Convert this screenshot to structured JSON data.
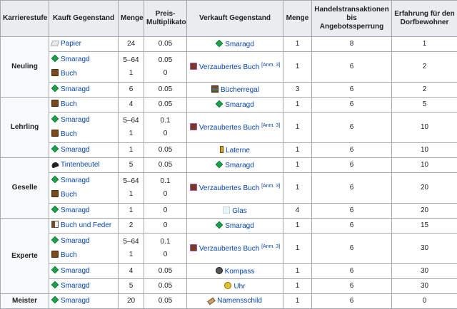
{
  "headers": [
    "Karrierestufe",
    "Kauft Gegenstand",
    "Menge",
    "Preis-Multiplikator",
    "Verkauft Gegenstand",
    "Menge",
    "Handelstransaktionen bis Angebotssperrung",
    "Erfahrung für den Dorfbewohner"
  ],
  "note": "[Anm. 3]",
  "careers": [
    "Neuling",
    "Lehrling",
    "Geselle",
    "Experte",
    "Meister"
  ],
  "rows": [
    {
      "buy": [
        {
          "icon": "paper-icon",
          "name": "Papier"
        }
      ],
      "qty": [
        "24"
      ],
      "mult": [
        "0.05"
      ],
      "sell": {
        "icon": "bookshelf-icon",
        "name": "Smaragd",
        "cls": "emerald"
      },
      "sqty": "1",
      "trades": "8",
      "xp": "1"
    },
    {
      "buy": [
        {
          "name": "Smaragd"
        },
        {
          "name": "Buch"
        }
      ],
      "qty": [
        "5–64",
        "1"
      ],
      "mult": [
        "0.05",
        "0"
      ],
      "sell": {
        "name": "Verzaubertes Buch"
      },
      "sqty": "1",
      "trades": "6",
      "xp": "2"
    },
    {
      "buy": [
        {
          "name": "Smaragd"
        }
      ],
      "qty": [
        "6"
      ],
      "mult": [
        "0.05"
      ],
      "sell": {
        "name": "Bücherregal"
      },
      "sqty": "3",
      "trades": "6",
      "xp": "2"
    },
    {
      "buy": [
        {
          "name": "Buch"
        }
      ],
      "qty": [
        "4"
      ],
      "mult": [
        "0.05"
      ],
      "sell": {
        "name": "Smaragd"
      },
      "sqty": "1",
      "trades": "6",
      "xp": "5"
    },
    {
      "buy": [
        {
          "name": "Smaragd"
        },
        {
          "name": "Buch"
        }
      ],
      "qty": [
        "5–64",
        "1"
      ],
      "mult": [
        "0.1",
        "0"
      ],
      "sell": {
        "name": "Verzaubertes Buch"
      },
      "sqty": "1",
      "trades": "6",
      "xp": "10"
    },
    {
      "buy": [
        {
          "name": "Smaragd"
        }
      ],
      "qty": [
        "1"
      ],
      "mult": [
        "0.05"
      ],
      "sell": {
        "name": "Laterne"
      },
      "sqty": "1",
      "trades": "6",
      "xp": "10"
    },
    {
      "buy": [
        {
          "name": "Tintenbeutel"
        }
      ],
      "qty": [
        "5"
      ],
      "mult": [
        "0.05"
      ],
      "sell": {
        "name": "Smaragd"
      },
      "sqty": "1",
      "trades": "6",
      "xp": "10"
    },
    {
      "buy": [
        {
          "name": "Smaragd"
        },
        {
          "name": "Buch"
        }
      ],
      "qty": [
        "5–64",
        "1"
      ],
      "mult": [
        "0.1",
        "0"
      ],
      "sell": {
        "name": "Verzaubertes Buch"
      },
      "sqty": "1",
      "trades": "6",
      "xp": "20"
    },
    {
      "buy": [
        {
          "name": "Smaragd"
        }
      ],
      "qty": [
        "1"
      ],
      "mult": [
        "0"
      ],
      "sell": {
        "name": "Glas"
      },
      "sqty": "4",
      "trades": "6",
      "xp": "20"
    },
    {
      "buy": [
        {
          "name": "Buch und Feder"
        }
      ],
      "qty": [
        "2"
      ],
      "mult": [
        "0"
      ],
      "sell": {
        "name": "Smaragd"
      },
      "sqty": "1",
      "trades": "6",
      "xp": "15"
    },
    {
      "buy": [
        {
          "name": "Smaragd"
        },
        {
          "name": "Buch"
        }
      ],
      "qty": [
        "5–64",
        "1"
      ],
      "mult": [
        "0.1",
        "0"
      ],
      "sell": {
        "name": "Verzaubertes Buch"
      },
      "sqty": "1",
      "trades": "6",
      "xp": "30"
    },
    {
      "buy": [
        {
          "name": "Smaragd"
        }
      ],
      "qty": [
        "4"
      ],
      "mult": [
        "0.05"
      ],
      "sell": {
        "name": "Kompass"
      },
      "sqty": "1",
      "trades": "6",
      "xp": "30"
    },
    {
      "buy": [
        {
          "name": "Smaragd"
        }
      ],
      "qty": [
        "5"
      ],
      "mult": [
        "0.05"
      ],
      "sell": {
        "name": "Uhr"
      },
      "sqty": "1",
      "trades": "6",
      "xp": "30"
    },
    {
      "buy": [
        {
          "name": "Smaragd"
        }
      ],
      "qty": [
        "20"
      ],
      "mult": [
        "0.05"
      ],
      "sell": {
        "name": "Namensschild"
      },
      "sqty": "1",
      "trades": "6",
      "xp": "0"
    }
  ]
}
